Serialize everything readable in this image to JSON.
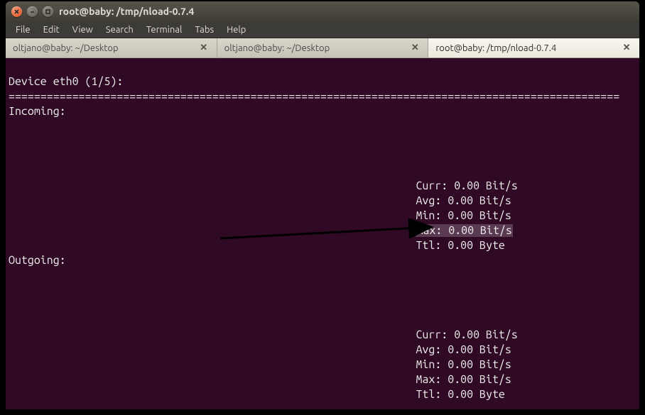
{
  "window": {
    "title": "root@baby: /tmp/nload-0.7.4"
  },
  "menu": {
    "file": "File",
    "edit": "Edit",
    "view": "View",
    "search": "Search",
    "terminal": "Terminal",
    "tabs": "Tabs",
    "help": "Help"
  },
  "tabs": {
    "t0": "oltjano@baby: ~/Desktop",
    "t1": "oltjano@baby: ~/Desktop",
    "t2": "root@baby: /tmp/nload-0.7.4"
  },
  "nload": {
    "device_line": "Device eth0 (1/5):",
    "divider": "================================================================================================",
    "incoming_label": "Incoming:",
    "outgoing_label": "Outgoing:",
    "in": {
      "curr": "Curr: 0.00 Bit/s",
      "avg": "Avg: 0.00 Bit/s",
      "min": "Min: 0.00 Bit/s",
      "max": "Max: 0.00 Bit/s",
      "ttl": "Ttl: 0.00 Byte"
    },
    "out": {
      "curr": "Curr: 0.00 Bit/s",
      "avg": "Avg: 0.00 Bit/s",
      "min": "Min: 0.00 Bit/s",
      "max": "Max: 0.00 Bit/s",
      "ttl": "Ttl: 0.00 Byte"
    }
  }
}
